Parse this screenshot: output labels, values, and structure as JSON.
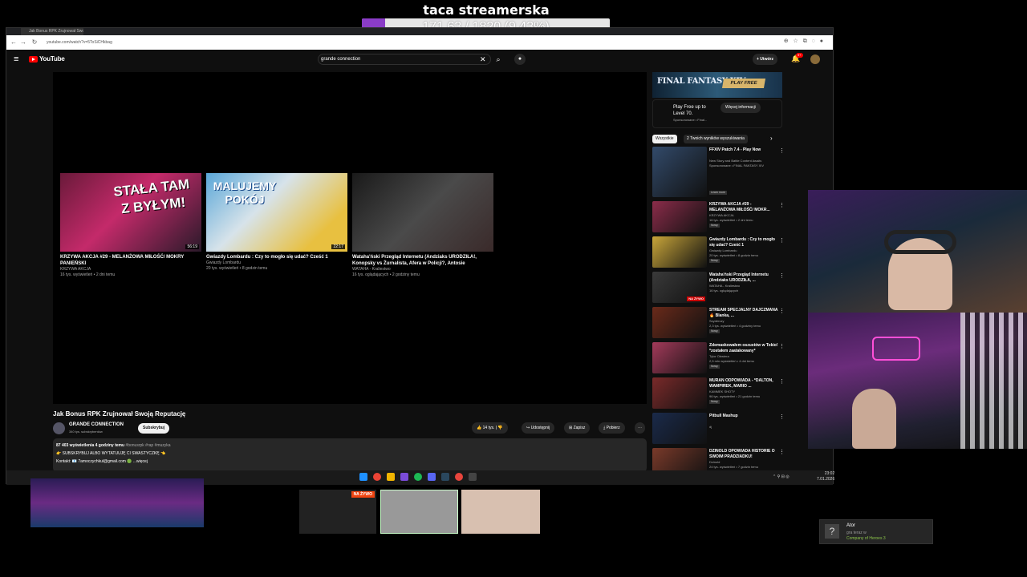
{
  "overlay": {
    "stream_title": "taca streamerska",
    "goal_text": "171.63 / 1820 (9.43%)",
    "goal_fraction": 0.0943,
    "accent": "#8a3cc7"
  },
  "browser": {
    "url": "youtube.com/watch?v=5ToSiCHkbag"
  },
  "youtube": {
    "logo": "YouTube",
    "search_value": "grande connection",
    "create_label": "+ Utwórz",
    "notification_badge": "9+",
    "end_cards": [
      {
        "title": "KRZYWA AKCJA #29 - MELANŻOWA MIŁOŚĆ/ MOKRY PANIEŃSKI",
        "channel": "KRZYWA AKCJA",
        "meta": "16 tys. wyświetleń • 2 dni temu",
        "duration": "56:19",
        "thumb_text": "STAŁA TAM Z BYŁYM!"
      },
      {
        "title": "Gwiazdy Lombardu : Czy to mogło się udać? Cześć 1",
        "channel": "Gwiazdy Lombardu",
        "meta": "20 tys. wyświetleń • 8 godzin temu",
        "duration": "22:17",
        "thumb_text": "MALUJEMY POKÓJ"
      },
      {
        "title": "Wataha'ński Przegląd Internetu (Andziaks URODZIŁA!, Konopsky vs Żurnalista, Afera w Policji?, Antosie",
        "channel": "WATAHA - Kraliestwo",
        "meta": "16 tys. oglądających • 2 godziny temu",
        "duration": "",
        "thumb_text": ""
      }
    ],
    "video_title": "Jak Bonus RPK Zrujnował Swoją Reputację",
    "channel_name": "GRANDE CONNECTION",
    "subscribers": "340 tys. subskrybentów",
    "subscribe_label": "Subskrybuj",
    "actions": {
      "likes": "14 tys.",
      "share": "Udostępnij",
      "save": "Zapisz",
      "download": "Pobierz",
      "more": "⋯"
    },
    "description": {
      "stats": "87 403 wyświetlenia  4 godziny temu",
      "tags": "#bonusrpk #rap #muzyka",
      "line2": "👉 SUBSKRYBUJ ALBO WYTATUUJĘ CI SWASTYCZKĘ 👈",
      "line3": "Kontakt: 📧 7amoczychkul@gmail.com 🟢 ...więcej"
    },
    "ad": {
      "banner_text": "FINAL FANTASY XIV",
      "banner_cta": "PLAY FREE",
      "text": "Play Free up to Level 70.",
      "sponsor": "Sponsorowane • Final...",
      "button": "Więcej informacji"
    },
    "chips": [
      "Wszystkie",
      "2 Twoich wyników wyszukiwania"
    ],
    "recommendations": [
      {
        "title": "FFXIV Patch 7.4 - Play Now",
        "channel": "New Story and Battle Content Awaits",
        "meta": "Sponsorowane • FINAL FANTASY XIV",
        "badge": "Learn more",
        "thumb": "#324a6a",
        "tall": true
      },
      {
        "title": "KRZYWA AKCJA #29 - MELANŻOWA MIŁOŚĆ/ MOKR...",
        "channel": "KRZYWA AKCJA",
        "meta": "16 tys. wyświetleń • 2 dni temu",
        "badge": "Nowy",
        "thumb": "#8b2c4a"
      },
      {
        "title": "Gwiazdy Lombardu : Czy to mogło się udać? Cześć 1",
        "channel": "Gwiazdy Lombardu",
        "meta": "20 tys. wyświetleń • 8 godzin temu",
        "badge": "Nowy",
        "thumb": "#c8a53a"
      },
      {
        "title": "Wataha'ński Przegląd Internetu (Andziaks URODZIŁA, ...",
        "channel": "WATAHA - Kraliestwo",
        "meta": "16 tys. oglądających",
        "badge": "NA ŻYWO",
        "thumb": "#3a3a3a"
      },
      {
        "title": "STREAM SPECJALNY DAJCZMANA 🔥 Blanka, ...",
        "channel": "Szyderczy",
        "meta": "2,3 tys. wyświetleń • 4 godziny temu",
        "badge": "Nowy",
        "thumb": "#6a2a1a"
      },
      {
        "title": "Zdemaskowałem oszustów w Tokio! *zostałem zaatakowany*",
        "channel": "Tylor Obwiera",
        "meta": "2,5 mln wyświetleń • 4 dni temu",
        "badge": "Nowy",
        "thumb": "#a33a5a"
      },
      {
        "title": "MURAN ODPOWIADA - *DALTON, WAMPIREK, MARIO ...",
        "channel": "KAMMEK SHOTY",
        "meta": "96 tys. wyświetleń • 21 godzin temu",
        "badge": "Nowy",
        "thumb": "#7a2a2a"
      },
      {
        "title": "Pitbull Mashup",
        "channel": "dj",
        "meta": "",
        "badge": "",
        "thumb": "#1a2a4a"
      },
      {
        "title": "DZINOLD OPOWIADA HISTORIE O SWOIM PRADZIADKU!",
        "channel": "Dzinold",
        "meta": "24 tys. wyświetleń • 7 godzin temu",
        "badge": "",
        "thumb": "#7a3a2a"
      }
    ]
  },
  "taskbar": {
    "time": "23:02",
    "date": "7.01.2026"
  },
  "tiles": {
    "live_label": "NA ŻYWO"
  },
  "game_widget": {
    "name": "Ator",
    "status": "gra teraz w",
    "game": "Company of Heroes 3",
    "icon": "?"
  }
}
